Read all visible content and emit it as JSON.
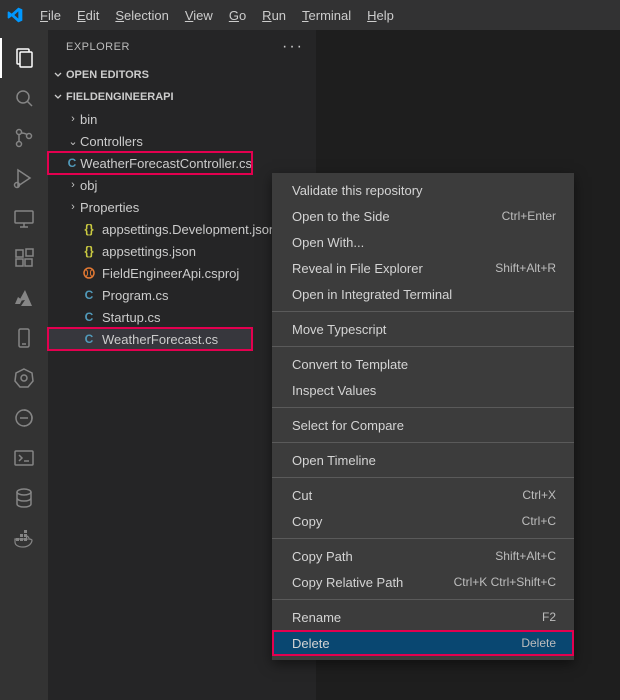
{
  "menu": [
    "File",
    "Edit",
    "Selection",
    "View",
    "Go",
    "Run",
    "Terminal",
    "Help"
  ],
  "explorer": {
    "title": "EXPLORER",
    "openEditors": "OPEN EDITORS",
    "project": "FIELDENGINEERAPI"
  },
  "tree": {
    "bin": "bin",
    "controllers": "Controllers",
    "weatherController": "WeatherForecastController.cs",
    "obj": "obj",
    "properties": "Properties",
    "appsettingsDev": "appsettings.Development.json",
    "appsettings": "appsettings.json",
    "csproj": "FieldEngineerApi.csproj",
    "program": "Program.cs",
    "startup": "Startup.cs",
    "weatherForecast": "WeatherForecast.cs"
  },
  "ctx": {
    "validate": "Validate this repository",
    "openSide": "Open to the Side",
    "openSideKey": "Ctrl+Enter",
    "openWith": "Open With...",
    "reveal": "Reveal in File Explorer",
    "revealKey": "Shift+Alt+R",
    "openTerm": "Open in Integrated Terminal",
    "moveTs": "Move Typescript",
    "convert": "Convert to Template",
    "inspect": "Inspect Values",
    "selectCompare": "Select for Compare",
    "timeline": "Open Timeline",
    "cut": "Cut",
    "cutKey": "Ctrl+X",
    "copy": "Copy",
    "copyKey": "Ctrl+C",
    "copyPath": "Copy Path",
    "copyPathKey": "Shift+Alt+C",
    "copyRel": "Copy Relative Path",
    "copyRelKey": "Ctrl+K Ctrl+Shift+C",
    "rename": "Rename",
    "renameKey": "F2",
    "delete": "Delete",
    "deleteKey": "Delete"
  }
}
